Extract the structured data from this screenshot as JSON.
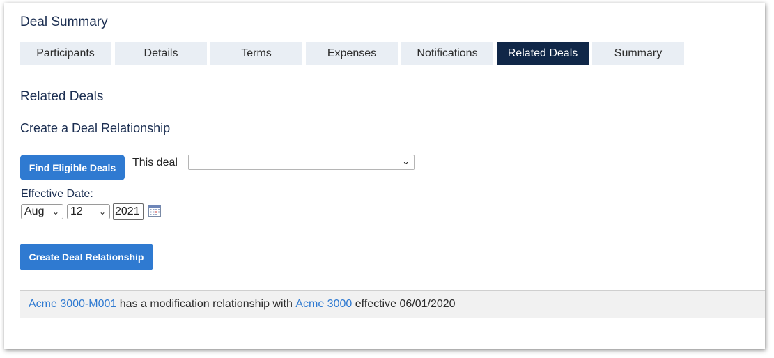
{
  "page": {
    "title": "Deal Summary"
  },
  "tabs": [
    {
      "label": "Participants",
      "active": false
    },
    {
      "label": "Details",
      "active": false
    },
    {
      "label": "Terms",
      "active": false
    },
    {
      "label": "Expenses",
      "active": false
    },
    {
      "label": "Notifications",
      "active": false
    },
    {
      "label": "Related Deals",
      "active": true
    },
    {
      "label": "Summary",
      "active": false
    }
  ],
  "section": {
    "title": "Related Deals",
    "subtitle": "Create a Deal Relationship"
  },
  "form": {
    "find_button": "Find Eligible Deals",
    "this_deal_label": "This deal",
    "this_deal_value": "",
    "effective_date_label": "Effective Date:",
    "month": "Aug",
    "day": "12",
    "year": "2021",
    "create_button": "Create Deal Relationship"
  },
  "relationship": {
    "deal": "Acme 3000-M001",
    "text": " has a modification relationship with ",
    "related_deal": "Acme 3000",
    "effective_text": " effective 06/01/2020"
  },
  "icons": {
    "calendar": "calendar-icon",
    "dropdown": "chevron-down-icon"
  },
  "colors": {
    "accent": "#2f7ad1",
    "active_tab": "#102748",
    "heading": "#1c2f52"
  }
}
